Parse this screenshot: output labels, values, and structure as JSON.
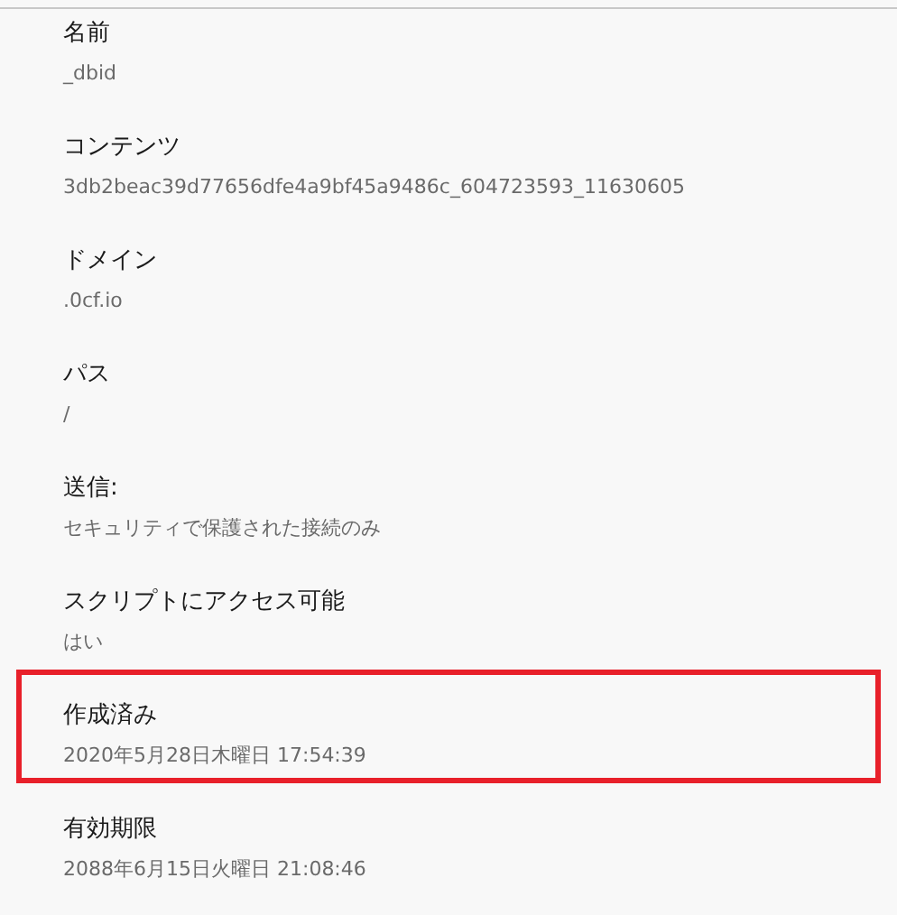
{
  "properties": [
    {
      "label": "名前",
      "value": "_dbid",
      "highlighted": false
    },
    {
      "label": "コンテンツ",
      "value": "3db2beac39d77656dfe4a9bf45a9486c_604723593_11630605",
      "highlighted": false
    },
    {
      "label": "ドメイン",
      "value": ".0cf.io",
      "highlighted": false
    },
    {
      "label": "パス",
      "value": "/",
      "highlighted": false
    },
    {
      "label": "送信:",
      "value": "セキュリティで保護された接続のみ",
      "highlighted": false
    },
    {
      "label": "スクリプトにアクセス可能",
      "value": "はい",
      "highlighted": false
    },
    {
      "label": "作成済み",
      "value": "2020年5月28日木曜日 17:54:39",
      "highlighted": true
    },
    {
      "label": "有効期限",
      "value": "2088年6月15日火曜日 21:08:46",
      "highlighted": false
    }
  ]
}
